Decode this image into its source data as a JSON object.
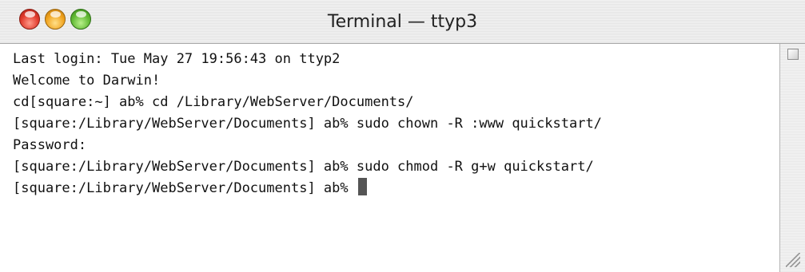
{
  "window": {
    "title": "Terminal — ttyp3"
  },
  "terminal": {
    "lines": [
      "Last login: Tue May 27 19:56:43 on ttyp2",
      "Welcome to Darwin!",
      "cd[square:~] ab% cd /Library/WebServer/Documents/",
      "[square:/Library/WebServer/Documents] ab% sudo chown -R :www quickstart/",
      "Password:",
      "[square:/Library/WebServer/Documents] ab% sudo chmod -R g+w quickstart/",
      "[square:/Library/WebServer/Documents] ab%"
    ]
  },
  "icons": {
    "close": "close-button-icon",
    "minimize": "minimize-button-icon",
    "zoom": "zoom-button-icon",
    "cursor": "text-cursor-icon",
    "scroll": "scroll-indicator-icon",
    "resize": "resize-grip-icon"
  },
  "colors": {
    "close": "#e0392b",
    "minimize": "#f0a21c",
    "zoom": "#5fb832",
    "text": "#111111",
    "background": "#ffffff"
  }
}
